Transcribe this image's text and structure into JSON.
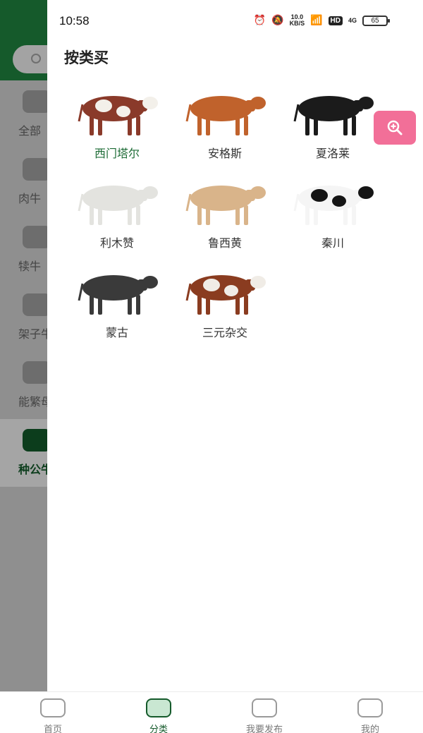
{
  "status_bar": {
    "time": "10:58",
    "network_speed": "10.0",
    "network_unit": "KB/S",
    "hd": "HD",
    "signal": "4G",
    "battery": "65"
  },
  "background_sidebar": {
    "items": [
      {
        "label": "全部"
      },
      {
        "label": "肉牛"
      },
      {
        "label": "犊牛"
      },
      {
        "label": "架子牛"
      },
      {
        "label": "能繁母牛"
      },
      {
        "label": "种公牛"
      }
    ],
    "active_index": 5,
    "header_color": "#155a2b"
  },
  "drawer": {
    "title": "按类买",
    "breeds": [
      {
        "name": "西门塔尔",
        "selected": true,
        "coat": "#8a3a2a",
        "patch": "#f3f0ea"
      },
      {
        "name": "安格斯",
        "selected": false,
        "coat": "#c0622c",
        "patch": "#c0622c"
      },
      {
        "name": "夏洛莱",
        "selected": false,
        "coat": "#1b1b1b",
        "patch": "#1b1b1b"
      },
      {
        "name": "利木赞",
        "selected": false,
        "coat": "#e3e3df",
        "patch": "#e3e3df"
      },
      {
        "name": "鲁西黄",
        "selected": false,
        "coat": "#d9b48a",
        "patch": "#d9b48a"
      },
      {
        "name": "秦川",
        "selected": false,
        "coat": "#f5f5f5",
        "patch": "#151515"
      },
      {
        "name": "蒙古",
        "selected": false,
        "coat": "#3a3a3a",
        "patch": "#3a3a3a"
      },
      {
        "name": "三元杂交",
        "selected": false,
        "coat": "#8a3c20",
        "patch": "#f0ece6"
      }
    ]
  },
  "floating_button": {
    "icon": "zoom-in-icon",
    "color": "#f26f98"
  },
  "tabbar": {
    "tabs": [
      {
        "label": "首页",
        "icon": "home-face-icon"
      },
      {
        "label": "分类",
        "icon": "category-list-icon"
      },
      {
        "label": "我要发布",
        "icon": "publish-plus-icon"
      },
      {
        "label": "我的",
        "icon": "profile-face-icon"
      }
    ],
    "active_index": 1,
    "accent": "#155a2b"
  }
}
